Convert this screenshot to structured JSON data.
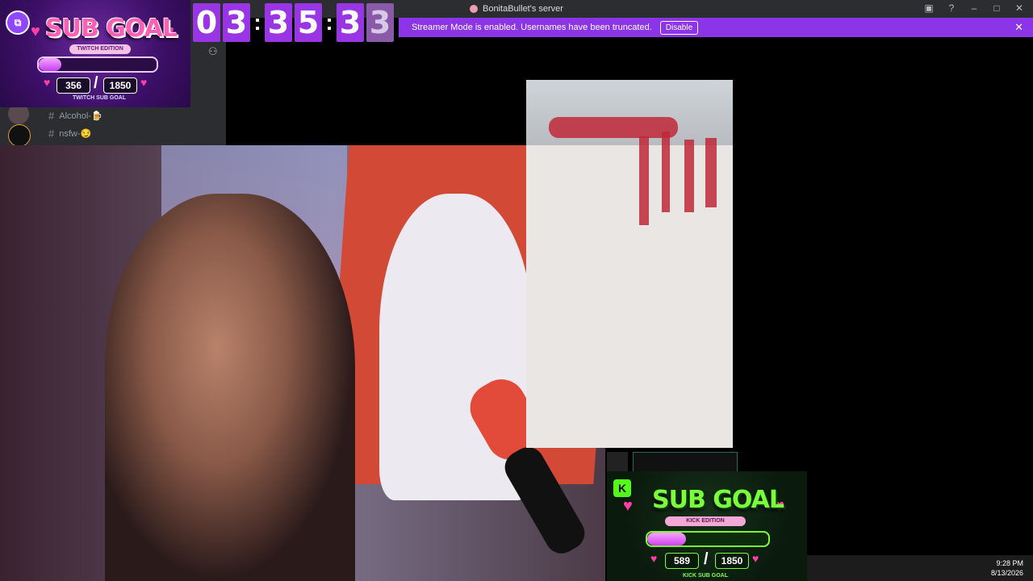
{
  "titlebar": {
    "server_name": "BonitaBullet's server"
  },
  "banner": {
    "message": "Streamer Mode is enabled. Usernames have been truncated.",
    "button_label": "Disable"
  },
  "sidebar": {
    "channels": [
      {
        "name": "Alcohol-🍺"
      },
      {
        "name": "nsfw-😏"
      }
    ]
  },
  "countdown": {
    "digits": [
      "0",
      "3",
      ":",
      "3",
      "5",
      ":",
      "3",
      "3"
    ]
  },
  "twitch_goal": {
    "title": "SUB GOAL",
    "edition": "TWITCH EDITION",
    "current": "356",
    "target": "1850",
    "footer": "TWITCH SUB GOAL",
    "progress": 0.19,
    "accent": "#9146ff"
  },
  "kick_goal": {
    "title": "SUB GOAL",
    "edition": "KICK EDITION",
    "current": "589",
    "target": "1850",
    "footer": "KICK SUB GOAL",
    "progress": 0.32,
    "accent": "#53fc18"
  },
  "clock": {
    "time": "9:28 PM",
    "date": "8/13/2026"
  },
  "colors": {
    "banner": "#8c35e8",
    "countdown": "#9a35e6",
    "titlebar": "#2b2d31"
  },
  "icons": [
    "twitch-logo-icon",
    "add-friend-icon",
    "inbox-icon",
    "help-icon",
    "minimize-icon",
    "maximize-icon",
    "close-icon",
    "kick-logo-icon"
  ]
}
